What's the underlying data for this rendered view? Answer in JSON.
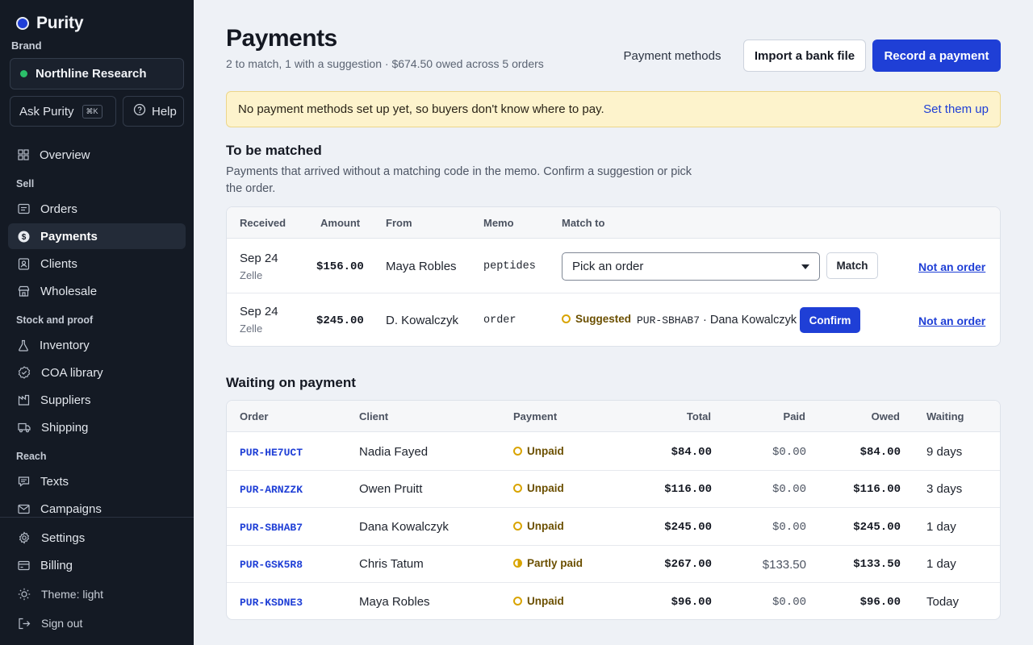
{
  "app": {
    "name": "Purity"
  },
  "sidebar": {
    "brand_label": "Brand",
    "brand_name": "Northline Research",
    "ask_label": "Ask Purity",
    "ask_shortcut": "⌘K",
    "help_label": "Help",
    "overview": "Overview",
    "sections": {
      "sell": "Sell",
      "stock": "Stock and proof",
      "reach": "Reach"
    },
    "sell_items": [
      "Orders",
      "Payments",
      "Clients",
      "Wholesale"
    ],
    "stock_items": [
      "Inventory",
      "COA library",
      "Suppliers",
      "Shipping"
    ],
    "reach_items": [
      "Texts",
      "Campaigns"
    ],
    "footer_items": [
      "Settings",
      "Billing",
      "Theme: light",
      "Sign out"
    ],
    "active_item": "Payments"
  },
  "header": {
    "title": "Payments",
    "subtitle": "2 to match, 1 with a suggestion · $674.50 owed across 5 orders",
    "payment_methods": "Payment methods",
    "import_bank_file": "Import a bank file",
    "record_payment": "Record a payment"
  },
  "alert": {
    "text": "No payment methods set up yet, so buyers don't know where to pay.",
    "link": "Set them up"
  },
  "to_match": {
    "title": "To be matched",
    "description": "Payments that arrived without a matching code in the memo. Confirm a suggestion or pick the order.",
    "columns": [
      "Received",
      "Amount",
      "From",
      "Memo",
      "Match to"
    ],
    "rows": [
      {
        "date": "Sep 24",
        "method": "Zelle",
        "amount": "$156.00",
        "from": "Maya Robles",
        "memo": "peptides",
        "select_value": "Pick an order",
        "action": "Match",
        "dismiss": "Not an order"
      },
      {
        "date": "Sep 24",
        "method": "Zelle",
        "amount": "$245.00",
        "from": "D. Kowalczyk",
        "memo": "order",
        "suggested_label": "Suggested",
        "suggested_order": "PUR-SBHAB7",
        "suggested_client": " · Dana Kowalczyk",
        "action": "Confirm",
        "dismiss": "Not an order"
      }
    ]
  },
  "waiting": {
    "title": "Waiting on payment",
    "columns": [
      "Order",
      "Client",
      "Payment",
      "Total",
      "Paid",
      "Owed",
      "Waiting"
    ],
    "rows": [
      {
        "order": "PUR-HE7UCT",
        "client": "Nadia Fayed",
        "status": "Unpaid",
        "total": "$84.00",
        "paid": "$0.00",
        "owed": "$84.00",
        "waiting": "9 days"
      },
      {
        "order": "PUR-ARNZZK",
        "client": "Owen Pruitt",
        "status": "Unpaid",
        "total": "$116.00",
        "paid": "$0.00",
        "owed": "$116.00",
        "waiting": "3 days"
      },
      {
        "order": "PUR-SBHAB7",
        "client": "Dana Kowalczyk",
        "status": "Unpaid",
        "total": "$245.00",
        "paid": "$0.00",
        "owed": "$245.00",
        "waiting": "1 day"
      },
      {
        "order": "PUR-GSK5R8",
        "client": "Chris Tatum",
        "status": "Partly paid",
        "total": "$267.00",
        "paid": "$133.50",
        "owed": "$133.50",
        "waiting": "1 day"
      },
      {
        "order": "PUR-KSDNE3",
        "client": "Maya Robles",
        "status": "Unpaid",
        "total": "$96.00",
        "paid": "$0.00",
        "owed": "$96.00",
        "waiting": "Today"
      }
    ]
  },
  "colors": {
    "accent": "#1f3fd6",
    "sidebar": "#141a24",
    "warning": "#d9a400",
    "alert_bg": "#fdf3cc"
  }
}
